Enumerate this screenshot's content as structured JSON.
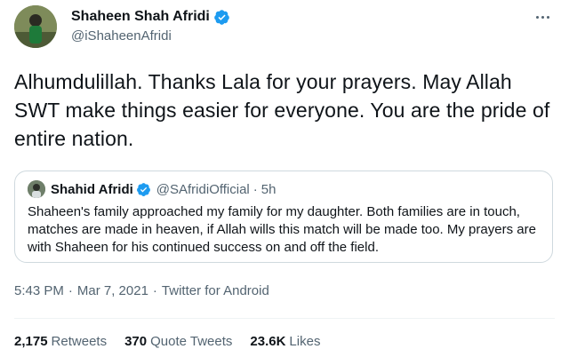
{
  "author": {
    "display_name": "Shaheen Shah Afridi",
    "handle": "@iShaheenAfridi",
    "verified_icon": "verified-badge-icon"
  },
  "tweet": {
    "text": "Alhumdulillah. Thanks Lala for your prayers. May Allah SWT make things easier for everyone. You are the pride of entire nation."
  },
  "quoted_tweet": {
    "display_name": "Shahid Afridi",
    "handle": "@SAfridiOfficial",
    "separator": "·",
    "time": "5h",
    "text": "Shaheen's family approached my family for my daughter. Both families are in touch, matches are made in heaven, if Allah wills this match will be made too. My prayers are with Shaheen for his continued success on and off the field."
  },
  "meta": {
    "time": "5:43 PM",
    "separator": "·",
    "date": "Mar 7, 2021",
    "source": "Twitter for Android"
  },
  "stats": {
    "retweets_count": "2,175",
    "retweets_label": "Retweets",
    "quote_count": "370",
    "quote_label": "Quote Tweets",
    "likes_count": "23.6K",
    "likes_label": "Likes"
  },
  "colors": {
    "verified": "#1d9bf0",
    "text": "#0f1419",
    "secondary": "#536471",
    "border": "#cfd9de"
  }
}
